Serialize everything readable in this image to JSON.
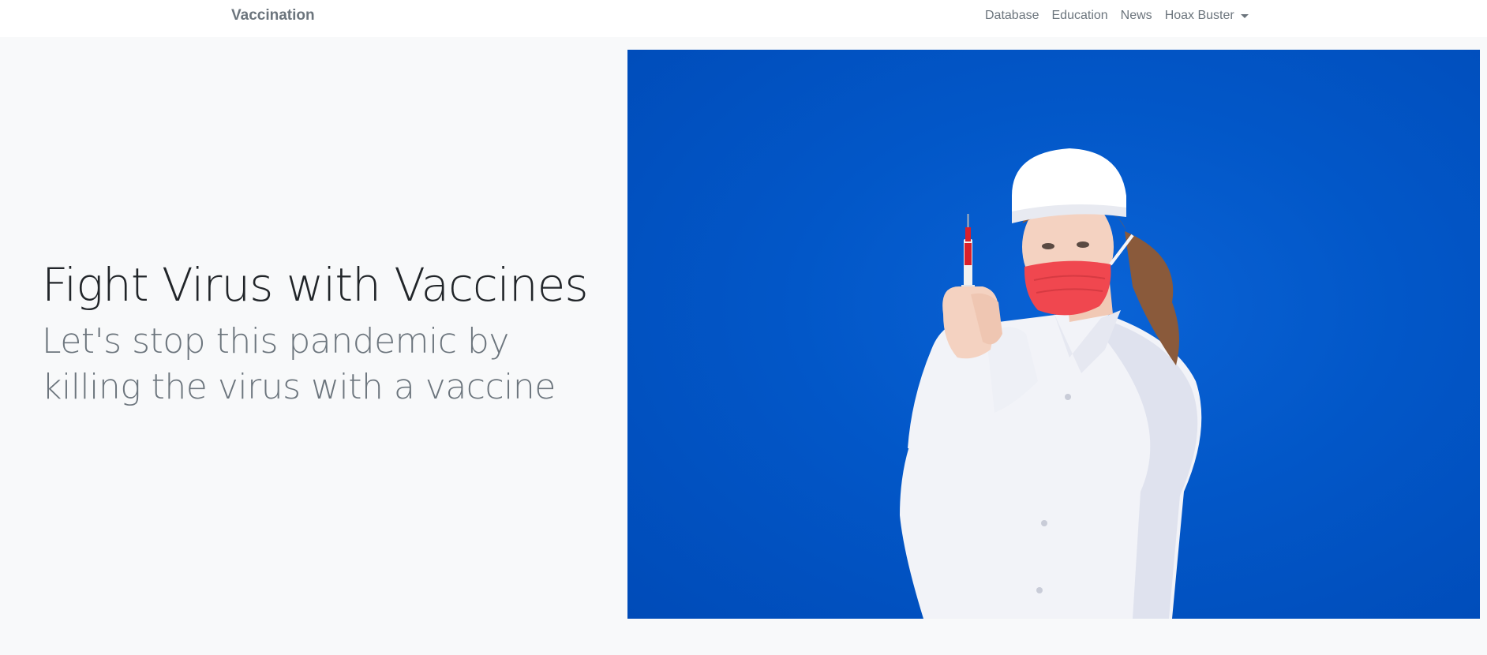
{
  "navbar": {
    "brand": "Vaccination",
    "links": [
      "Database",
      "Education",
      "News"
    ],
    "dropdown": "Hoax Buster"
  },
  "hero": {
    "title": "Fight Virus with Vaccines",
    "subtitle": "Let's stop this pandemic by killing the virus with a vaccine"
  },
  "colors": {
    "image_background": "#0057c9",
    "mask": "#f0474f",
    "coat": "#f2f3f8",
    "syringe_fluid": "#d9202b"
  }
}
